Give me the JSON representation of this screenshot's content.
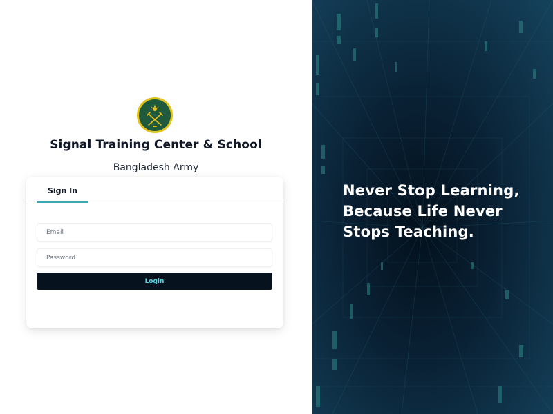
{
  "organization": {
    "name": "Signal Training Center & School",
    "subtitle": "Bangladesh Army",
    "emblem_icon": "bangladesh-army-emblem",
    "emblem_colors": {
      "ring": "#e3c21a",
      "fill": "#1f5a3e"
    }
  },
  "auth": {
    "tabs": [
      {
        "label": "Sign In",
        "active": true
      }
    ],
    "email_placeholder": "Email",
    "password_placeholder": "Password",
    "login_label": "Login"
  },
  "hero": {
    "lines": [
      "Never Stop Learning,",
      "Because Life Never",
      "Stops Teaching."
    ],
    "background": "digital-data-tunnel"
  },
  "colors": {
    "accent": "#3aa7b3",
    "button_bg": "#06131f",
    "button_text": "#5ad1df",
    "hero_bg": "#07182a"
  }
}
